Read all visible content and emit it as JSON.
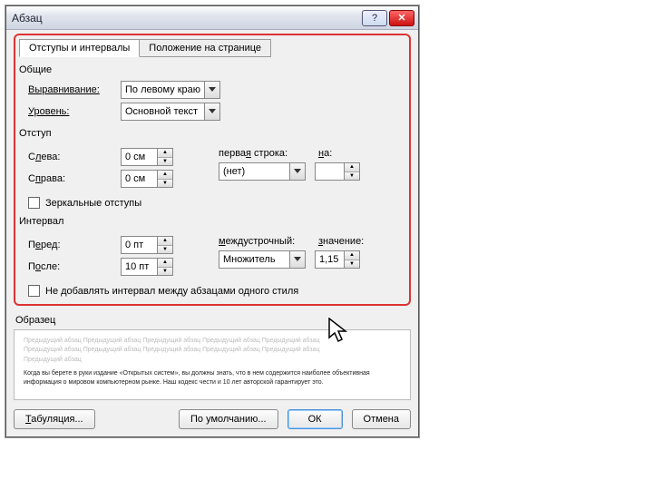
{
  "window": {
    "title": "Абзац"
  },
  "tabs": {
    "indents": "Отступы и интервалы",
    "position": "Положение на странице"
  },
  "general": {
    "title": "Общие",
    "align_label": "Выравнивание:",
    "align_value": "По левому краю",
    "level_label": "Уровень:",
    "level_value": "Основной текст"
  },
  "indent": {
    "title": "Отступ",
    "left_label": "Слева:",
    "left_value": "0 см",
    "right_label": "Справа:",
    "right_value": "0 см",
    "first_label": "первая строка:",
    "first_value": "(нет)",
    "by_label": "на:",
    "by_value": "",
    "mirror": "Зеркальные отступы"
  },
  "spacing": {
    "title": "Интервал",
    "before_label": "Перед:",
    "before_value": "0 пт",
    "after_label": "После:",
    "after_value": "10 пт",
    "line_label": "междустрочный:",
    "line_value": "Множитель",
    "val_label": "значение:",
    "val_value": "1,15",
    "nospread": "Не добавлять интервал между абзацами одного стиля"
  },
  "preview": {
    "title": "Образец",
    "ghost1": "Предыдущий абзац Предыдущий абзац Предыдущий абзац Предыдущий абзац Предыдущий абзац",
    "ghost2": "Предыдущий абзац Предыдущий абзац Предыдущий абзац Предыдущий абзац Предыдущий абзац",
    "ghost3": "Предыдущий абзац",
    "sample": "Когда вы берете в руки издание «Открытых систем», вы должны знать, что в нем содержится наиболее объективная информация о мировом компьютерном рынке. Наш кодекс чести и 10 лет авторской гарантирует это."
  },
  "buttons": {
    "tabs": "Табуляция...",
    "default": "По умолчанию...",
    "ok": "ОК",
    "cancel": "Отмена"
  }
}
